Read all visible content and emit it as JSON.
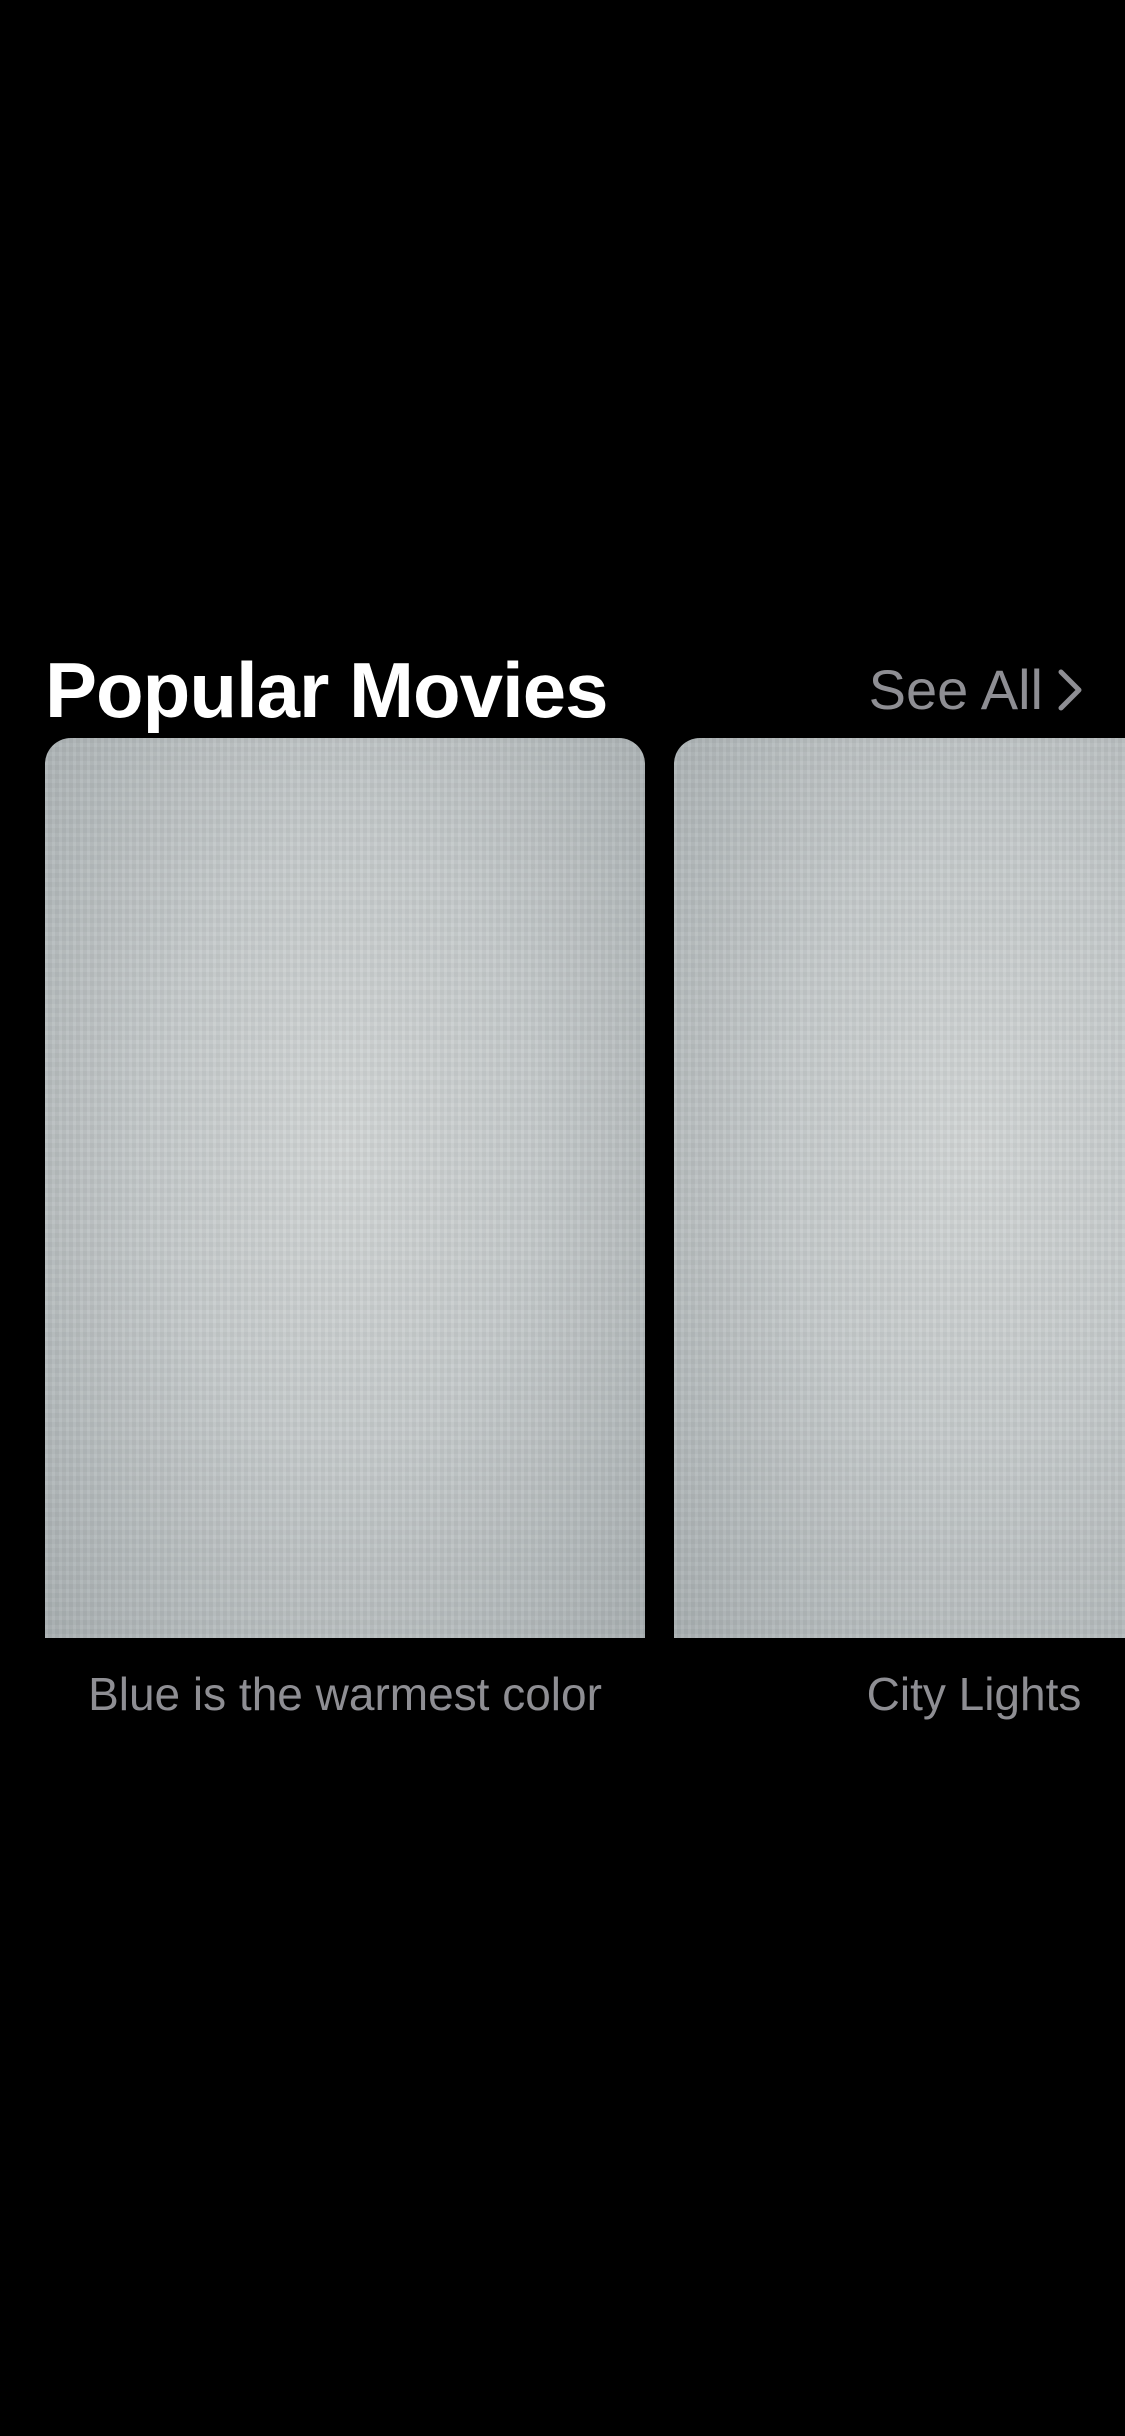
{
  "section": {
    "title": "Popular Movies",
    "see_all_label": "See All",
    "see_all_icon": "chevron-right-icon"
  },
  "movies": [
    {
      "title": "Blue is the warmest color"
    },
    {
      "title": "City Lights"
    }
  ],
  "colors": {
    "background": "#000000",
    "title": "#ffffff",
    "secondary_text": "#8e8e93"
  }
}
